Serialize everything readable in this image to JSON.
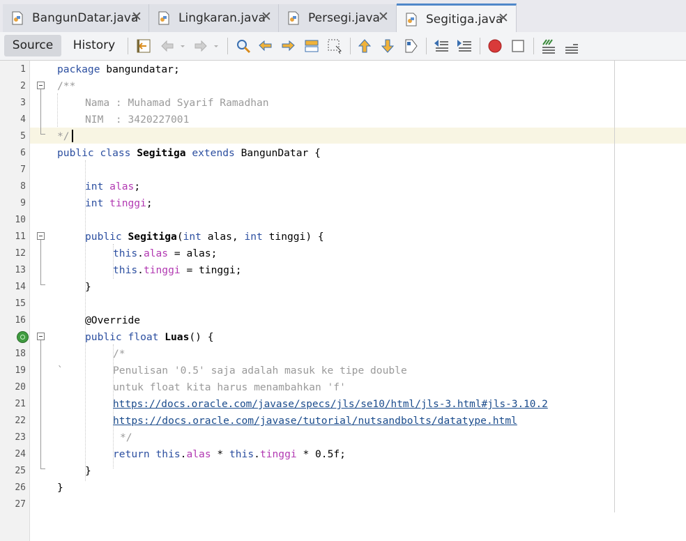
{
  "tabs": [
    {
      "label": "BangunDatar.java",
      "active": false
    },
    {
      "label": "Lingkaran.java",
      "active": false
    },
    {
      "label": "Persegi.java",
      "active": false
    },
    {
      "label": "Segitiga.java",
      "active": true
    }
  ],
  "close_glyph": "✕",
  "toolbar": {
    "source_label": "Source",
    "history_label": "History",
    "icons": [
      "last-edit-icon",
      "back-icon",
      "forward-icon",
      "find-icon",
      "find-previous-icon",
      "find-next-icon",
      "find-selection-icon",
      "toggle-highlight-icon",
      "previous-bookmark-icon",
      "next-bookmark-icon",
      "toggle-bookmark-icon",
      "shift-left-icon",
      "shift-right-icon",
      "start-macro-icon",
      "stop-macro-icon",
      "comment-icon",
      "uncomment-icon"
    ]
  },
  "editor": {
    "line_numbers": [
      "1",
      "2",
      "3",
      "4",
      "5",
      "6",
      "7",
      "8",
      "9",
      "10",
      "11",
      "12",
      "13",
      "14",
      "15",
      "16",
      "17",
      "18",
      "19",
      "20",
      "21",
      "22",
      "23",
      "24",
      "25",
      "26",
      "27"
    ],
    "code": {
      "l1_a": "package",
      "l1_b": " bangundatar;",
      "l2": "/**",
      "l3": "Nama : Muhamad Syarif Ramadhan",
      "l4": "NIM  : 3420227001",
      "l5": "*/",
      "l6_a": "public class",
      "l6_b": "Segitiga",
      "l6_c": "extends",
      "l6_d": " BangunDatar {",
      "l8_a": "int",
      "l8_b": "alas",
      "l8_c": ";",
      "l9_a": "int",
      "l9_b": "tinggi",
      "l9_c": ";",
      "l11_a": "public",
      "l11_b": "Segitiga",
      "l11_c": "(",
      "l11_d": "int",
      "l11_e": " alas, ",
      "l11_f": "int",
      "l11_g": " tinggi) {",
      "l12_a": "this",
      "l12_b": ".",
      "l12_c": "alas",
      "l12_d": " = alas;",
      "l13_a": "this",
      "l13_b": ".",
      "l13_c": "tinggi",
      "l13_d": " = tinggi;",
      "l14": "}",
      "l16": "@Override",
      "l17_a": "public float",
      "l17_b": "Luas",
      "l17_c": "() {",
      "l18": "/*",
      "l19_tick": "`",
      "l19": "Penulisan '0.5' saja adalah masuk ke tipe double",
      "l20": "untuk float kita harus menambahkan 'f'",
      "l21": "https://docs.oracle.com/javase/specs/jls/se10/html/jls-3.html#jls-3.10.2",
      "l22": "https://docs.oracle.com/javase/tutorial/nutsandbolts/datatype.html",
      "l23": "*/",
      "l24_a": "return",
      "l24_b": "this",
      "l24_c": ".",
      "l24_d": "alas",
      "l24_e": " * ",
      "l24_f": "this",
      "l24_g": ".",
      "l24_h": "tinggi",
      "l24_i": " * 0.5f;",
      "l25": "}",
      "l26": "}"
    }
  },
  "colors": {
    "keyword": "#2c4fa0",
    "comment": "#9a9a9a",
    "field": "#b239b2",
    "link": "#1a4b8c",
    "current_line": "#f8f5e3",
    "tab_accent": "#4f87c9"
  }
}
